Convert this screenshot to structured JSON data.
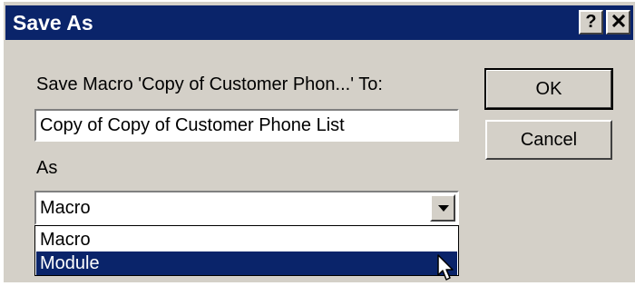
{
  "window": {
    "title": "Save As",
    "help_label": "?",
    "close_label": "✕"
  },
  "form": {
    "prompt": "Save Macro 'Copy of Customer Phon...' To:",
    "name_value": "Copy of Copy of Customer Phone List",
    "as_label": "As",
    "as_selected": "Macro",
    "as_options": [
      "Macro",
      "Module"
    ],
    "highlighted_option": "Module"
  },
  "buttons": {
    "ok_label": "OK",
    "cancel_label": "Cancel"
  },
  "colors": {
    "title_bar": "#0a246a",
    "dialog_face": "#d4d0c8",
    "highlight": "#0a246a"
  },
  "icons": {
    "dropdown_arrow": "chevron-down-icon",
    "cursor": "mouse-pointer-icon"
  }
}
